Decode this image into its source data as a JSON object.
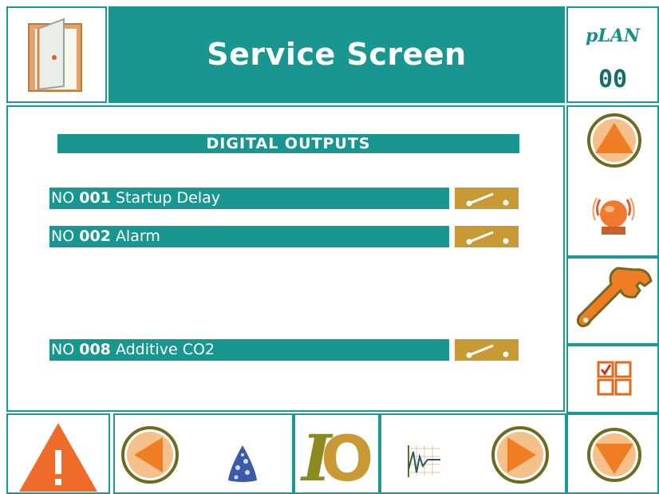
{
  "header": {
    "title": "Service Screen",
    "plan_label": "pLAN",
    "plan_address": "00"
  },
  "section": {
    "title": "DIGITAL OUTPUTS"
  },
  "outputs": [
    {
      "prefix": "NO",
      "code": "001",
      "label": "Startup Delay",
      "state": "open"
    },
    {
      "prefix": "NO",
      "code": "002",
      "label": "Alarm",
      "state": "open"
    },
    {
      "prefix": "NO",
      "code": "008",
      "label": "Additive CO2",
      "state": "open"
    }
  ],
  "icons": {
    "exit": "door-exit-icon",
    "up": "arrow-up-icon",
    "alarm": "alarm-bell-icon",
    "service": "wrench-icon",
    "menu": "grid-menu-icon",
    "down": "arrow-down-icon",
    "warning": "warning-icon",
    "prev": "arrow-left-icon",
    "fingerprint": "triangle-dots-icon",
    "io": "io-icon",
    "graph": "graph-icon",
    "next": "arrow-right-icon"
  },
  "colors": {
    "teal": "#18968f",
    "relay": "#c99a34",
    "orange": "#f08a2a",
    "olive": "#6e6b20"
  }
}
